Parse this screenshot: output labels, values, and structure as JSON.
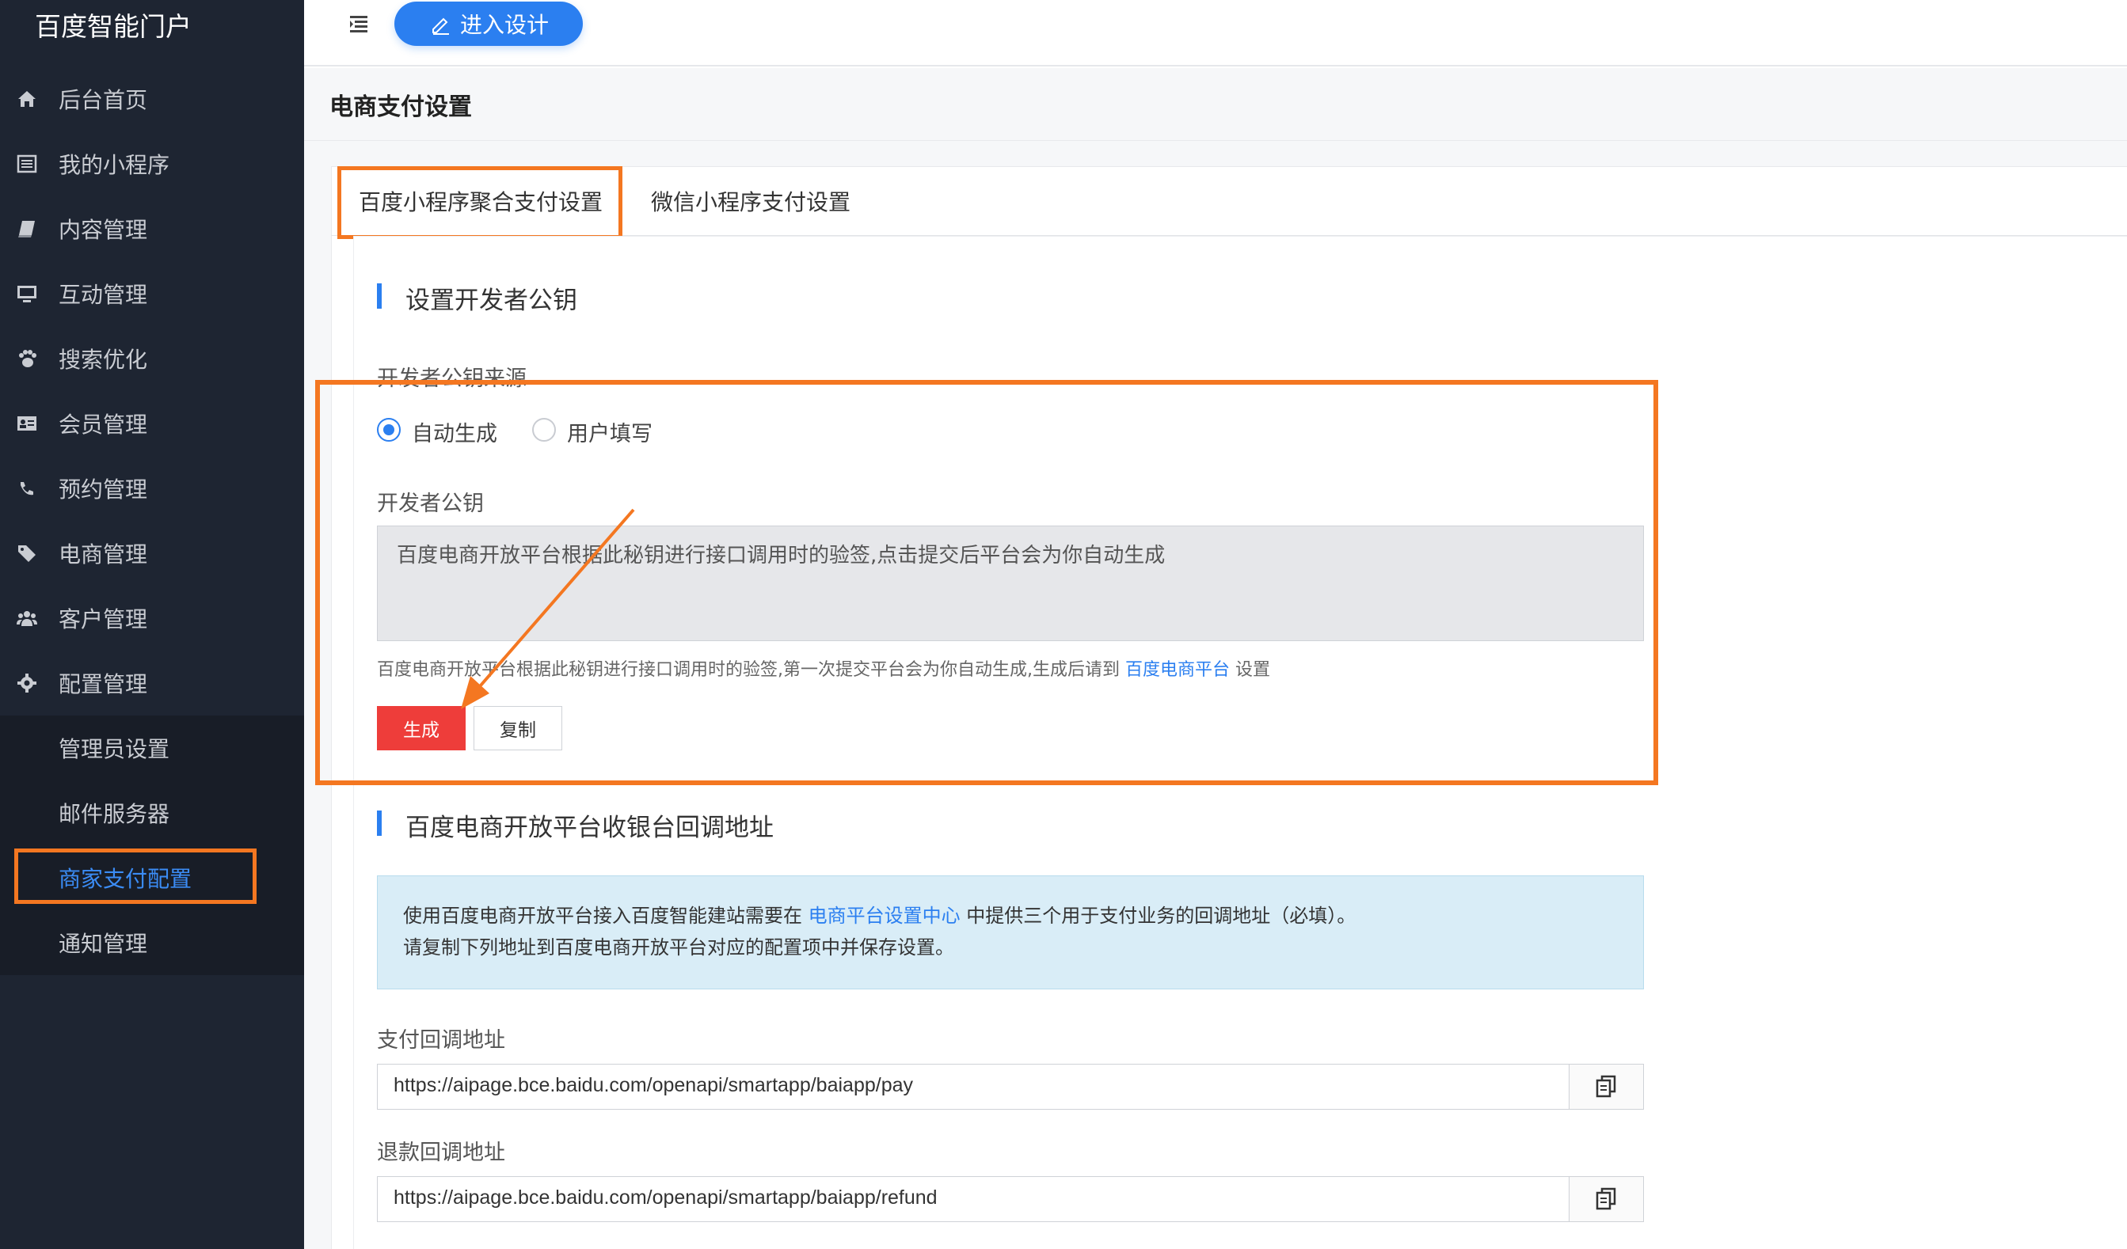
{
  "app": {
    "brand": "百度智能门户"
  },
  "sidebar": {
    "items": [
      {
        "label": "后台首页",
        "icon": "home-icon"
      },
      {
        "label": "我的小程序",
        "icon": "list-icon"
      },
      {
        "label": "内容管理",
        "icon": "book-icon"
      },
      {
        "label": "互动管理",
        "icon": "monitor-icon"
      },
      {
        "label": "搜索优化",
        "icon": "paw-icon"
      },
      {
        "label": "会员管理",
        "icon": "id-card-icon"
      },
      {
        "label": "预约管理",
        "icon": "phone-icon"
      },
      {
        "label": "电商管理",
        "icon": "tags-icon"
      },
      {
        "label": "客户管理",
        "icon": "users-icon"
      },
      {
        "label": "配置管理",
        "icon": "gear-icon"
      }
    ],
    "submenu": [
      {
        "label": "管理员设置"
      },
      {
        "label": "邮件服务器"
      },
      {
        "label": "商家支付配置",
        "active": true
      },
      {
        "label": "通知管理"
      }
    ]
  },
  "topbar": {
    "design_label": "进入设计"
  },
  "page": {
    "title": "电商支付设置"
  },
  "tabs": [
    {
      "label": "百度小程序聚合支付设置",
      "active": true
    },
    {
      "label": "微信小程序支付设置"
    }
  ],
  "section1": {
    "title": "设置开发者公钥",
    "source_label": "开发者公钥来源",
    "options": [
      "自动生成",
      "用户填写"
    ],
    "selected": "自动生成",
    "key_label": "开发者公钥",
    "key_placeholder": "百度电商开放平台根据此秘钥进行接口调用时的验签,点击提交后平台会为你自动生成",
    "help_prefix": "百度电商开放平台根据此秘钥进行接口调用时的验签,第一次提交平台会为你自动生成,生成后请到",
    "help_link": "百度电商平台",
    "help_suffix": "设置",
    "generate_label": "生成",
    "copy_label": "复制"
  },
  "section2": {
    "title": "百度电商开放平台收银台回调地址",
    "info_line1_prefix": "使用百度电商开放平台接入百度智能建站需要在",
    "info_line1_link": "电商平台设置中心",
    "info_line1_suffix": "中提供三个用于支付业务的回调地址（必填）。",
    "info_line2": "请复制下列地址到百度电商开放平台对应的配置项中并保存设置。",
    "pay_label": "支付回调地址",
    "pay_url": "https://aipage.bce.baidu.com/openapi/smartapp/baiapp/pay",
    "refund_label": "退款回调地址",
    "refund_url": "https://aipage.bce.baidu.com/openapi/smartapp/baiapp/refund"
  },
  "colors": {
    "accent": "#2b7ff0",
    "highlight": "#f47721",
    "danger": "#ee3d3a",
    "sidebar": "#1e2532"
  }
}
